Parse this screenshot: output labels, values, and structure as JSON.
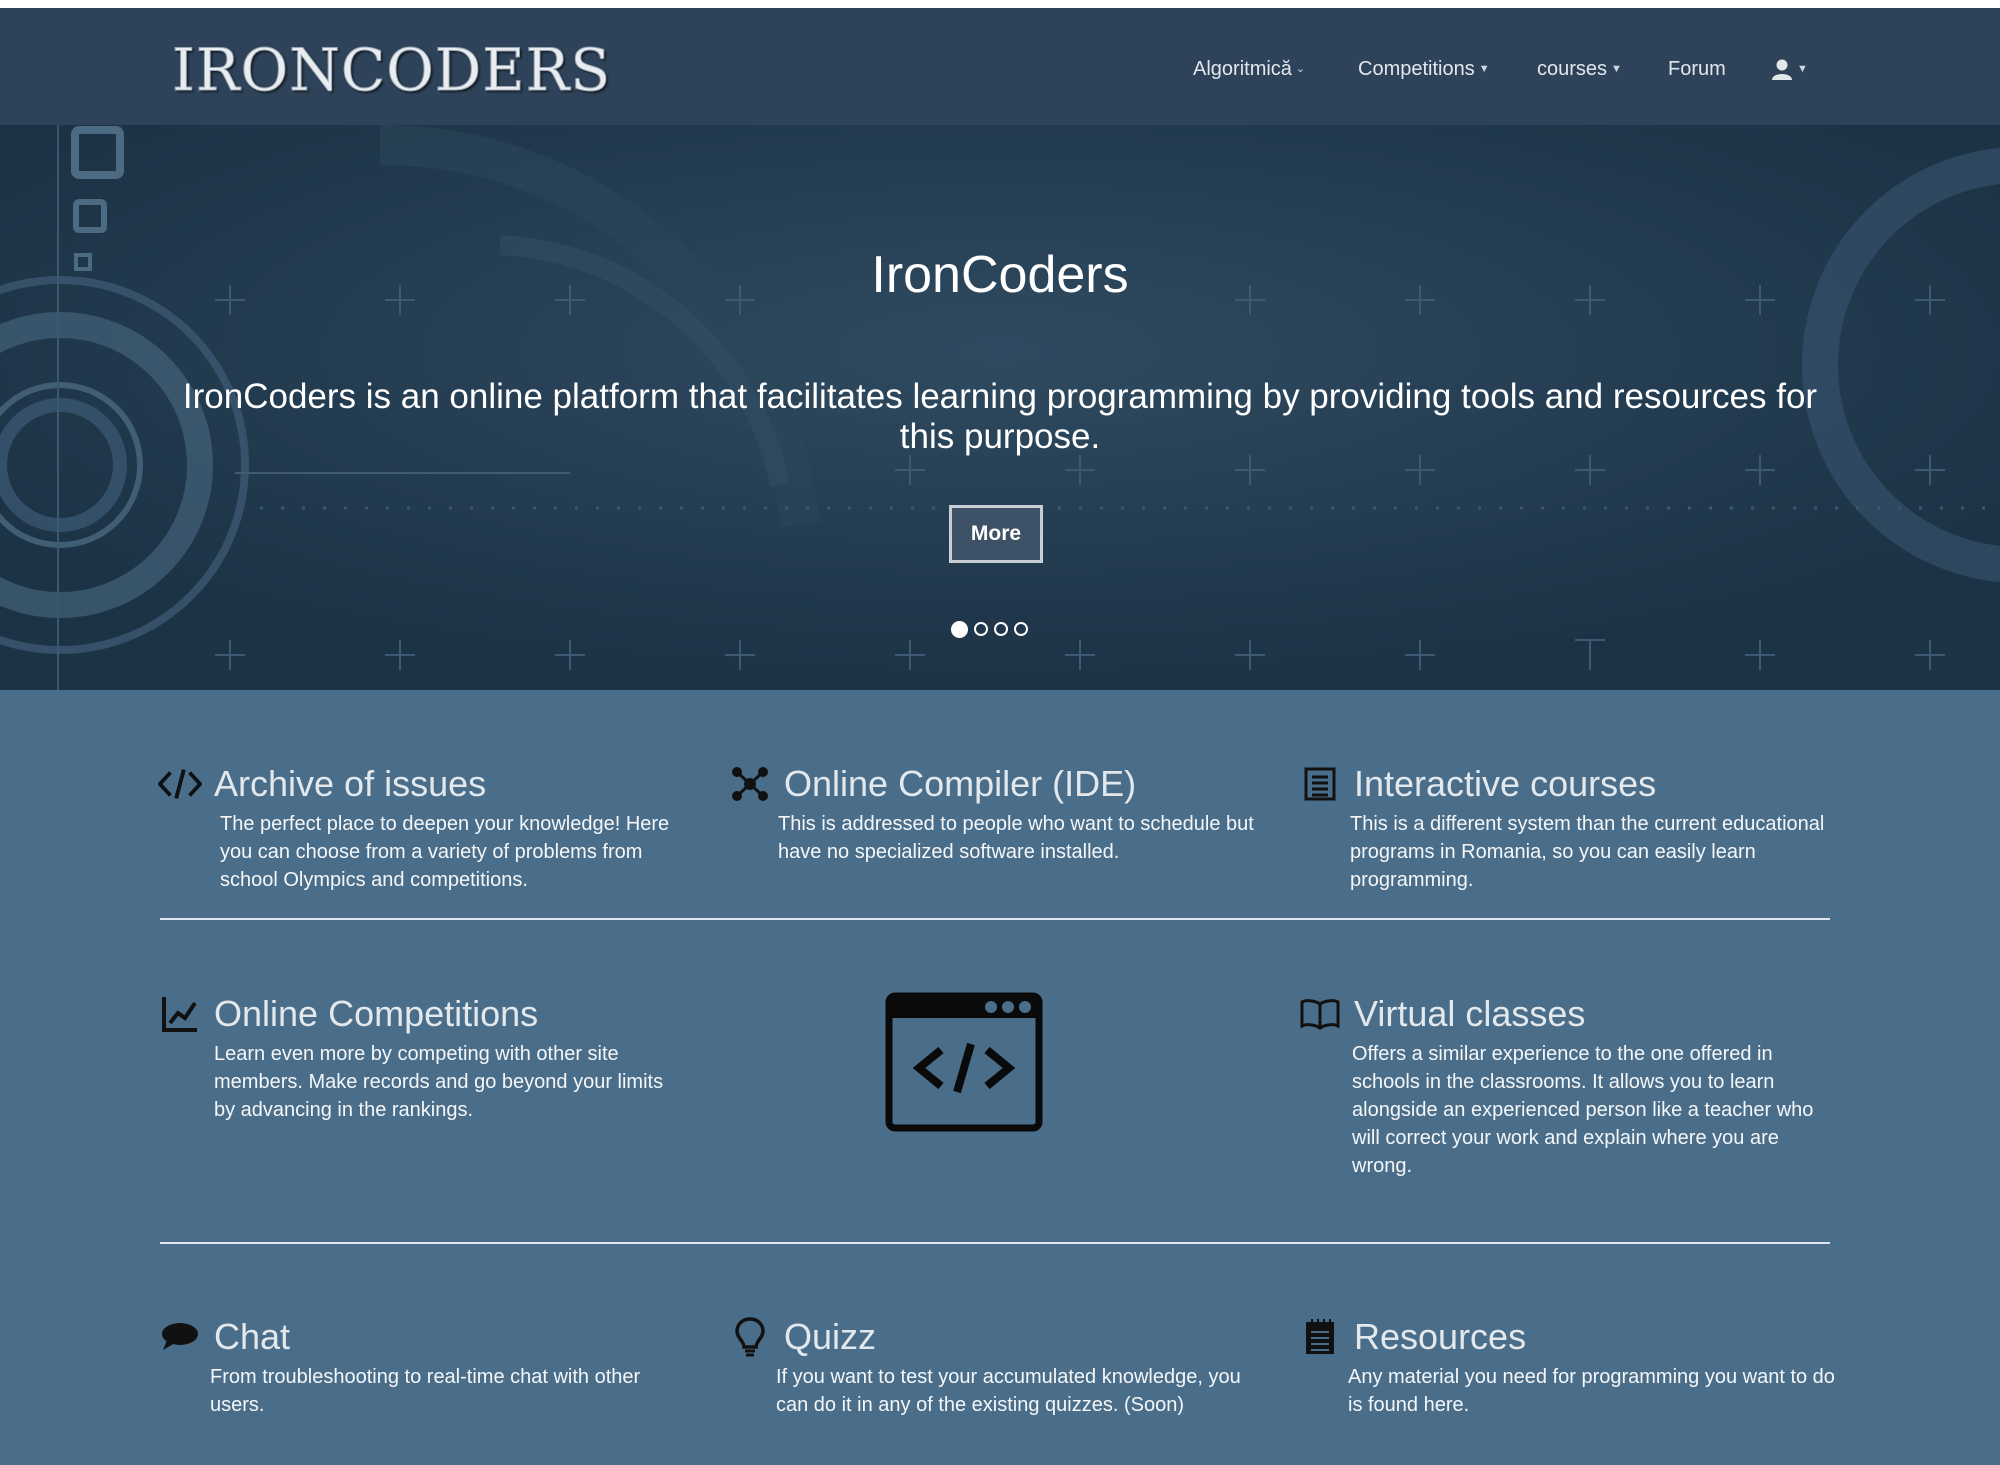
{
  "nav": {
    "logo": "IRONCODERS",
    "items": [
      {
        "label": "Algoritmică",
        "dropdown": true
      },
      {
        "label": "Competitions",
        "dropdown": true
      },
      {
        "label": "courses",
        "dropdown": true
      },
      {
        "label": "Forum",
        "dropdown": false
      }
    ],
    "user_icon": "user-icon"
  },
  "hero": {
    "title": "IronCoders",
    "text": "IronCoders is an online platform that facilitates learning programming by providing tools and resources for this purpose.",
    "button": "More",
    "slides": 4,
    "active_slide": 1
  },
  "features": [
    {
      "icon": "code-icon",
      "title": "Archive of issues",
      "desc": "The perfect place to deepen your knowledge! Here you can choose from a variety of problems from school Olympics and competitions."
    },
    {
      "icon": "nodes-icon",
      "title": "Online Compiler (IDE)",
      "desc": "This is addressed to people who want to schedule but have no specialized software installed."
    },
    {
      "icon": "list-icon",
      "title": "Interactive courses",
      "desc": "This is a different system than the current educational programs in Romania, so you can easily learn programming."
    },
    {
      "icon": "chart-icon",
      "title": "Online Competitions",
      "desc": "Learn even more by competing with other site members. Make records and go beyond your limits by advancing in the rankings."
    },
    {
      "icon": "book-icon",
      "title": "Virtual classes",
      "desc": "Offers a similar experience to the one offered in schools in the classrooms. It allows you to learn alongside an experienced person like a teacher who will correct your work and explain where you are wrong."
    },
    {
      "icon": "chat-icon",
      "title": "Chat",
      "desc": "From troubleshooting to real-time chat with other users."
    },
    {
      "icon": "lightbulb-icon",
      "title": "Quizz",
      "desc": "If you want to test your accumulated knowledge, you can do it in any of the existing quizzes. (Soon)"
    },
    {
      "icon": "notepad-icon",
      "title": "Resources",
      "desc": "Any material you need for programming you want to do is found here."
    }
  ],
  "center_icon": "code-window-icon",
  "colors": {
    "navbar": "#2e4359",
    "hero": "#223b50",
    "features": "#4a6e8a"
  }
}
